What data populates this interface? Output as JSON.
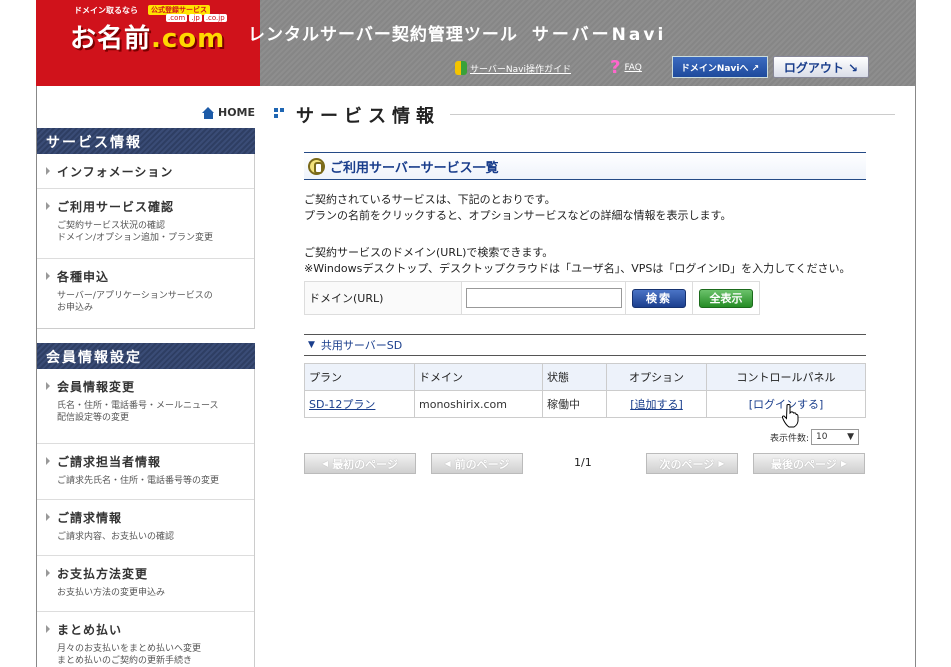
{
  "header": {
    "logo_tag": "ドメイン取るなら",
    "logo_badge": "公式登録サービス",
    "logo_domains": [
      ".com",
      ".jp",
      ".co.jp"
    ],
    "logo_main": "お名前",
    "logo_dot_com": ".com",
    "app_title": "レンタルサーバー契約管理ツール",
    "app_name": "サーバーNavi",
    "guide_label": "サーバーNavi操作ガイド",
    "faq_label": "FAQ",
    "domain_navi_label": "ドメインNaviへ ↗",
    "logout_label": "ログアウト ↘"
  },
  "sidebar": {
    "home_label": "HOME",
    "sections": [
      {
        "title": "サービス情報",
        "items": [
          {
            "title": "インフォメーション",
            "desc": ""
          },
          {
            "title": "ご利用サービス確認",
            "desc": "ご契約サービス状況の確認\nドメイン/オプション追加・プラン変更"
          },
          {
            "title": "各種申込",
            "desc": "サーバー/アプリケーションサービスの\nお申込み"
          }
        ]
      },
      {
        "title": "会員情報設定",
        "items": [
          {
            "title": "会員情報変更",
            "desc": "氏名・住所・電話番号・メールニュース\n配信設定等の変更"
          },
          {
            "title": "ご請求担当者情報",
            "desc": "ご請求先氏名・住所・電話番号等の変更"
          },
          {
            "title": "ご請求情報",
            "desc": "ご請求内容、お支払いの確認"
          },
          {
            "title": "お支払方法変更",
            "desc": "お支払い方法の変更申込み"
          },
          {
            "title": "まとめ払い",
            "desc": "月々のお支払いをまとめ払いへ変更\nまとめ払いのご契約の更新手続き"
          }
        ]
      }
    ]
  },
  "main": {
    "page_title": "サービス情報",
    "section_title": "ご利用サーバーサービス一覧",
    "intro_line1": "ご契約されているサービスは、下記のとおりです。",
    "intro_line2": "プランの名前をクリックすると、オプションサービスなどの詳細な情報を表示します。",
    "search_line1": "ご契約サービスのドメイン(URL)で検索できます。",
    "search_line2": "※Windowsデスクトップ、デスクトップクラウドは「ユーザ名」、VPSは「ログインID」を入力してください。",
    "search_label": "ドメイン(URL)",
    "search_value": "",
    "search_button": "検索",
    "show_all_button": "全表示",
    "group_title": "共用サーバーSD",
    "table": {
      "headers": [
        "プラン",
        "ドメイン",
        "状態",
        "オプション",
        "コントロールパネル"
      ],
      "rows": [
        {
          "plan": "SD-12プラン",
          "domain": "monoshirix.com",
          "status": "稼働中",
          "option": "[追加する]",
          "panel": "[ログインする]"
        }
      ]
    },
    "per_page_label": "表示件数:",
    "per_page_value": "10",
    "pager": {
      "first": "最初のページ",
      "prev": "前のページ",
      "count": "1/1",
      "next": "次のページ",
      "last": "最後のページ"
    }
  },
  "colors": {
    "brand_red": "#d0121b",
    "nav_navy": "#2e3e63",
    "link_blue": "#1a3e8c"
  }
}
